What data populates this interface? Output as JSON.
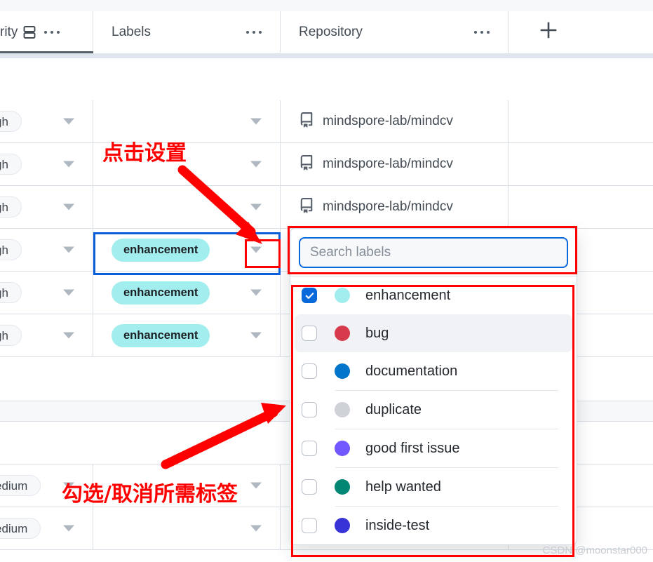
{
  "header": {
    "columns": [
      {
        "title": "rity",
        "icon": "group-rows-icon",
        "menu": "more-options-icon",
        "active": true
      },
      {
        "title": "Labels",
        "menu": "more-options-icon",
        "active": false
      },
      {
        "title": "Repository",
        "menu": "more-options-icon",
        "active": false
      }
    ],
    "add_column_label": "+"
  },
  "grid": {
    "rows": [
      {
        "priority": "gh",
        "label": "",
        "repository": "mindspore-lab/mindcv"
      },
      {
        "priority": "gh",
        "label": "",
        "repository": "mindspore-lab/mindcv"
      },
      {
        "priority": "gh",
        "label": "",
        "repository": "mindspore-lab/mindcv"
      },
      {
        "priority": "gh",
        "label": "enhancement",
        "repository": "",
        "selected": true
      },
      {
        "priority": "gh",
        "label": "enhancement",
        "repository": ""
      },
      {
        "priority": "gh",
        "label": "enhancement",
        "repository": ""
      }
    ],
    "bottom_rows": [
      {
        "priority": "edium",
        "label": "",
        "repository": ""
      },
      {
        "priority": "edium",
        "label": "",
        "repository": ""
      }
    ]
  },
  "dropdown": {
    "search_placeholder": "Search labels",
    "search_value": "",
    "items": [
      {
        "name": "enhancement",
        "color": "#a2eeef",
        "checked": true,
        "hover": false
      },
      {
        "name": "bug",
        "color": "#d73a4a",
        "checked": false,
        "hover": true
      },
      {
        "name": "documentation",
        "color": "#0075ca",
        "checked": false,
        "hover": false
      },
      {
        "name": "duplicate",
        "color": "#cfd3d7",
        "checked": false,
        "hover": false
      },
      {
        "name": "good first issue",
        "color": "#7057ff",
        "checked": false,
        "hover": false
      },
      {
        "name": "help wanted",
        "color": "#008672",
        "checked": false,
        "hover": false
      },
      {
        "name": "inside-test",
        "color": "#3733d6",
        "checked": false,
        "hover": false
      }
    ]
  },
  "annotations": {
    "click_settings": "点击设置",
    "toggle_labels": "勾选/取消所需标签"
  },
  "watermark": "CSDN @moonstar000",
  "colors": {
    "annotation_red": "#ff0000",
    "focus_blue": "#0b5ed7",
    "checkbox_blue": "#0969da",
    "chip_label_bg": "#a2eeef"
  }
}
